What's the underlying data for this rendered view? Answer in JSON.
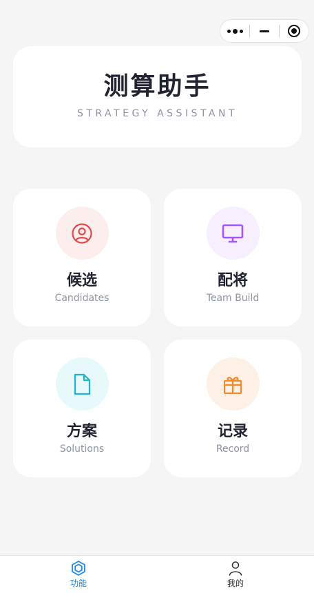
{
  "capsule": {
    "more_icon": "more-dots-icon",
    "minimize_icon": "minus-icon",
    "close_icon": "target-icon"
  },
  "hero": {
    "title": "测算助手",
    "subtitle": "STRATEGY ASSISTANT"
  },
  "cards": [
    {
      "title": "候选",
      "subtitle": "Candidates",
      "icon": "user-circle-icon",
      "icon_color": "#e5484d",
      "bg_color": "#fdeeee"
    },
    {
      "title": "配将",
      "subtitle": "Team Build",
      "icon": "monitor-icon",
      "icon_color": "#a855f7",
      "bg_color": "#f7effe"
    },
    {
      "title": "方案",
      "subtitle": "Solutions",
      "icon": "document-icon",
      "icon_color": "#1ab5cf",
      "bg_color": "#e8f9fc"
    },
    {
      "title": "记录",
      "subtitle": "Record",
      "icon": "gift-icon",
      "icon_color": "#f08a2b",
      "bg_color": "#fdf1e6"
    }
  ],
  "tabbar": {
    "items": [
      {
        "label": "功能",
        "icon": "hexagon-icon",
        "active": true
      },
      {
        "label": "我的",
        "icon": "user-icon",
        "active": false
      }
    ],
    "active_color": "#1e88e5",
    "inactive_color": "#333333"
  }
}
